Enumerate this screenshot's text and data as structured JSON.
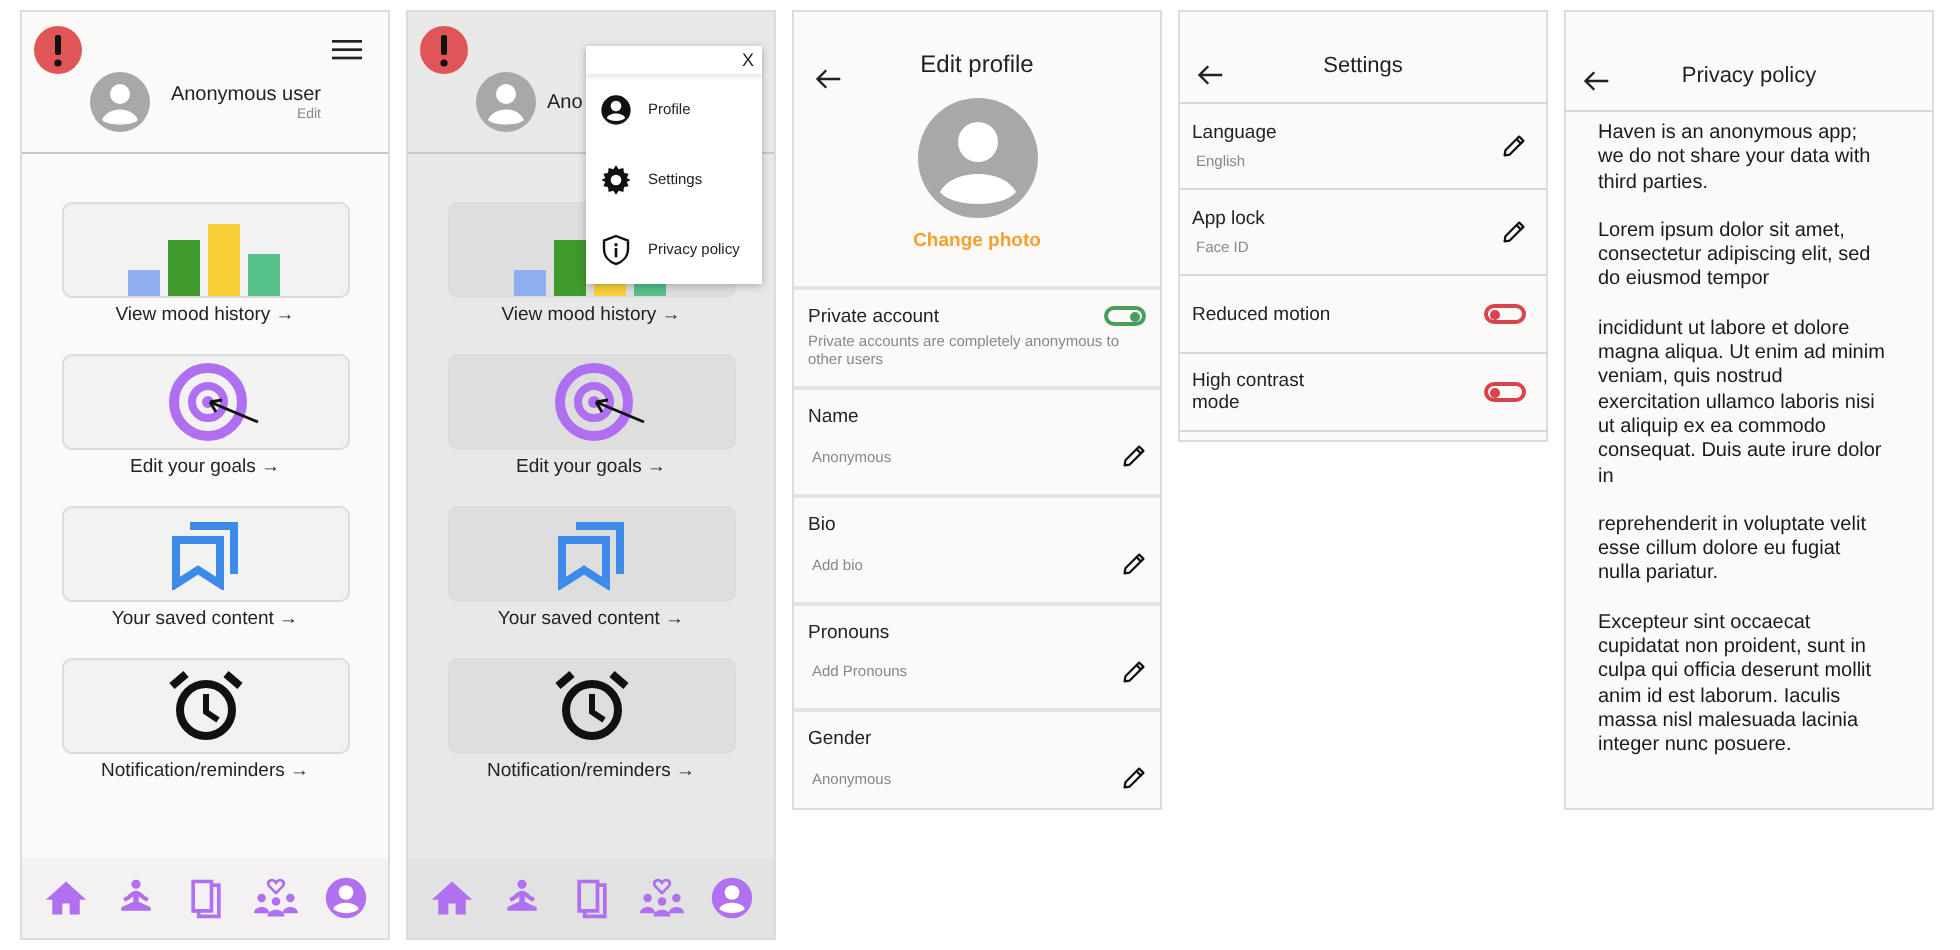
{
  "home": {
    "user_name": "Anonymous user",
    "edit_label": "Edit",
    "cards": [
      {
        "kind": "mood",
        "label": "View mood history →"
      },
      {
        "kind": "goals",
        "label": "Edit your goals →"
      },
      {
        "kind": "saved",
        "label": "Your saved content →"
      },
      {
        "kind": "alarm",
        "label": "Notification/reminders →"
      }
    ],
    "nav": [
      {
        "kind": "home"
      },
      {
        "kind": "meditate"
      },
      {
        "kind": "library"
      },
      {
        "kind": "community"
      },
      {
        "kind": "profile"
      }
    ]
  },
  "home_menu": {
    "user_name": "Ano",
    "cards": [
      {
        "kind": "mood",
        "label": "View mood history →"
      },
      {
        "kind": "goals",
        "label": "Edit your goals →"
      },
      {
        "kind": "saved",
        "label": "Your saved content →"
      },
      {
        "kind": "alarm",
        "label": "Notification/reminders →"
      }
    ],
    "nav": [
      {
        "kind": "home"
      },
      {
        "kind": "meditate"
      },
      {
        "kind": "library"
      },
      {
        "kind": "community"
      },
      {
        "kind": "profile"
      }
    ],
    "menu": {
      "close": "X",
      "items": [
        {
          "kind": "profile",
          "label": "Profile"
        },
        {
          "kind": "settings",
          "label": "Settings"
        },
        {
          "kind": "privacy",
          "label": "Privacy policy"
        }
      ]
    }
  },
  "edit_profile": {
    "title": "Edit profile",
    "change_photo": "Change photo",
    "private_account": {
      "label": "Private account",
      "description": "Private accounts are completely anonymous to other users",
      "on": true
    },
    "fields": [
      {
        "label": "Name",
        "value": "Anonymous"
      },
      {
        "label": "Bio",
        "value": "Add bio"
      },
      {
        "label": "Pronouns",
        "value": "Add Pronouns"
      },
      {
        "label": "Gender",
        "value": "Anonymous"
      }
    ]
  },
  "settings": {
    "title": "Settings",
    "rows": [
      {
        "kind": "edit",
        "label": "Language",
        "value": "English"
      },
      {
        "kind": "edit",
        "label": "App lock",
        "value": "Face ID"
      },
      {
        "kind": "toggle",
        "label": "Reduced motion",
        "on": false
      },
      {
        "kind": "toggle",
        "label": "High contrast mode",
        "on": false
      }
    ]
  },
  "privacy_policy": {
    "title": "Privacy policy",
    "paragraphs": [
      "Haven is an anonymous app; we do not share your data with third parties.",
      "Lorem ipsum dolor sit amet, consectetur adipiscing elit, sed do eiusmod tempor",
      "incididunt ut labore et dolore magna aliqua. Ut enim ad minim veniam, quis nostrud exercitation ullamco laboris nisi ut aliquip ex ea commodo consequat. Duis aute irure dolor in",
      "reprehenderit in voluptate velit esse cillum dolore eu fugiat nulla pariatur.",
      "Excepteur sint occaecat cupidatat non proident, sunt in culpa qui officia deserunt mollit anim id est laborum. Iaculis massa nisl malesuada lacinia integer nunc posuere."
    ]
  }
}
